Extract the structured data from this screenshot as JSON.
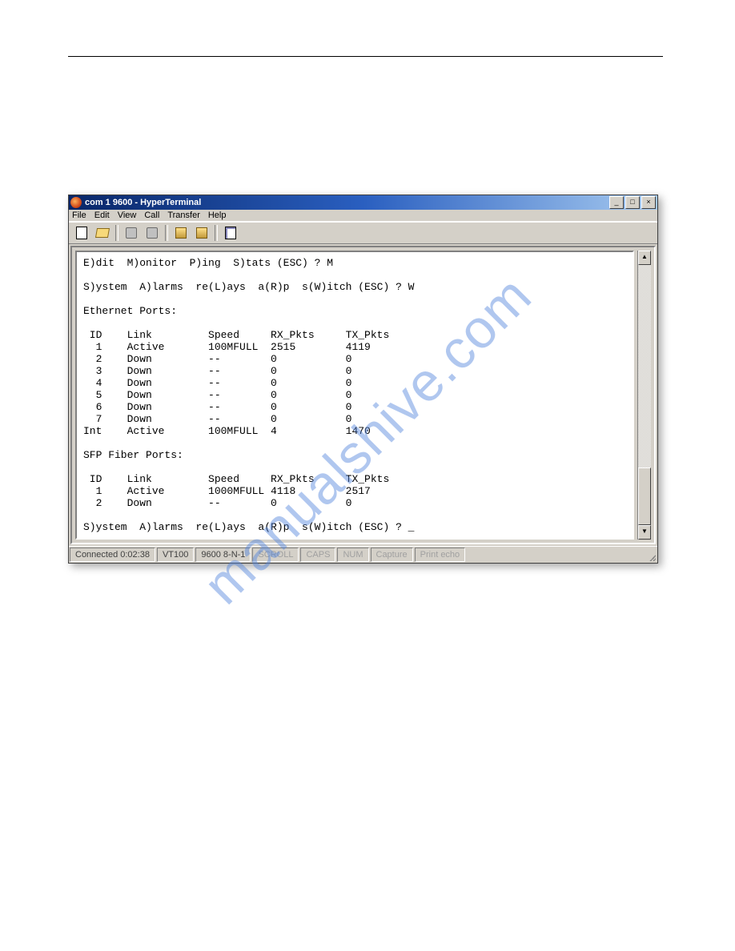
{
  "watermark": "manualshive.com",
  "window": {
    "title": "com 1 9600 - HyperTerminal",
    "buttons": {
      "min": "_",
      "max": "□",
      "close": "×"
    }
  },
  "menu": {
    "file": "File",
    "edit": "Edit",
    "view": "View",
    "call": "Call",
    "transfer": "Transfer",
    "help": "Help"
  },
  "toolbar_icons": {
    "new": "new-document-icon",
    "open": "open-folder-icon",
    "connect": "connect-phone-icon",
    "disconnect": "disconnect-phone-icon",
    "send": "send-file-icon",
    "receive": "receive-file-icon",
    "properties": "properties-icon"
  },
  "terminal": {
    "line_menu1": "E)dit  M)onitor  P)ing  S)tats (ESC) ? M",
    "line_menu2": "S)ystem  A)larms  re(L)ays  a(R)p  s(W)itch (ESC) ? W",
    "eth_header": "Ethernet Ports:",
    "eth_cols": " ID    Link         Speed     RX_Pkts     TX_Pkts",
    "eth_rows": [
      "  1    Active       100MFULL  2515        4119",
      "  2    Down         --        0           0",
      "  3    Down         --        0           0",
      "  4    Down         --        0           0",
      "  5    Down         --        0           0",
      "  6    Down         --        0           0",
      "  7    Down         --        0           0",
      "Int    Active       100MFULL  4           1470"
    ],
    "sfp_header": "SFP Fiber Ports:",
    "sfp_cols": " ID    Link         Speed     RX_Pkts     TX_Pkts",
    "sfp_rows": [
      "  1    Active       1000MFULL 4118        2517",
      "  2    Down         --        0           0"
    ],
    "line_prompt": "S)ystem  A)larms  re(L)ays  a(R)p  s(W)itch (ESC) ? _"
  },
  "status": {
    "connected": "Connected 0:02:38",
    "emulation": "VT100",
    "settings": "9600 8-N-1",
    "scroll": "SCROLL",
    "caps": "CAPS",
    "num": "NUM",
    "capture": "Capture",
    "printecho": "Print echo"
  }
}
